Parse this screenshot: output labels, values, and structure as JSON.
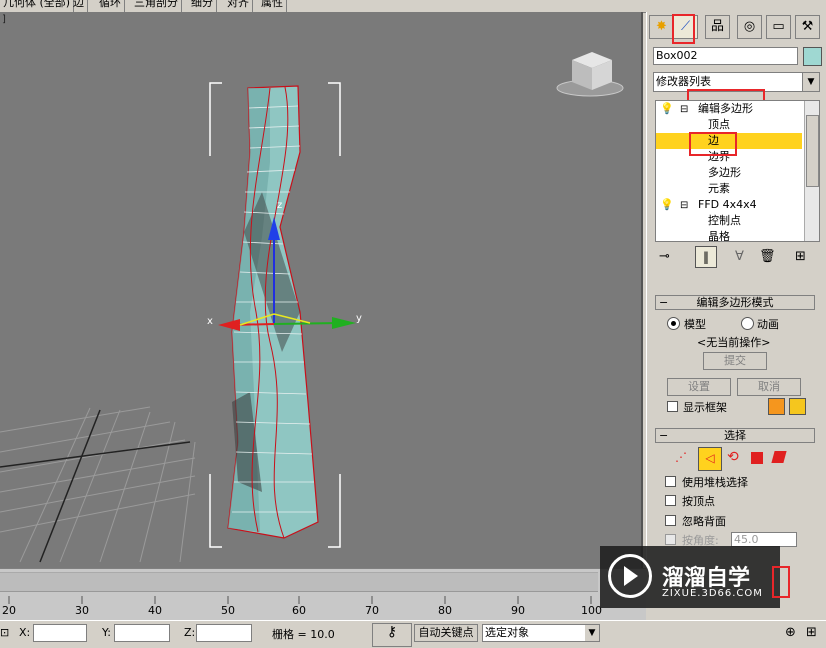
{
  "menubar": {
    "items": [
      "几何体 (全部)",
      "边",
      "循环",
      "三角剖分",
      "细分",
      "对齐",
      "属性"
    ]
  },
  "viewport": {
    "label": "]",
    "gizmo_x": "x",
    "gizmo_y": "y",
    "gizmo_z": "z"
  },
  "panel": {
    "tabs": [
      "create-icon",
      "modify-icon",
      "hierarchy-icon",
      "motion-icon",
      "display-icon",
      "utilities-icon"
    ],
    "object_name": "Box002",
    "object_color": "#9fd8d2",
    "modifier_list_label": "修改器列表",
    "stack": [
      {
        "label": "编辑多边形",
        "level": 0,
        "expand": "−",
        "selected": false
      },
      {
        "label": "顶点",
        "level": 1,
        "selected": false
      },
      {
        "label": "边",
        "level": 1,
        "selected": true
      },
      {
        "label": "边界",
        "level": 1,
        "selected": false
      },
      {
        "label": "多边形",
        "level": 1,
        "selected": false
      },
      {
        "label": "元素",
        "level": 1,
        "selected": false
      },
      {
        "label": "FFD 4x4x4",
        "level": 0,
        "expand": "−",
        "selected": false
      },
      {
        "label": "控制点",
        "level": 1,
        "selected": false
      },
      {
        "label": "晶格",
        "level": 1,
        "selected": false
      }
    ],
    "mode_rollout": {
      "title": "编辑多边形模式",
      "radio_model": "模型",
      "radio_anim": "动画",
      "no_op": "<无当前操作>",
      "commit": "提交",
      "settings": "设置",
      "cancel": "取消",
      "show_cage": "显示框架",
      "cage_color_1": "#f5961e",
      "cage_color_2": "#f5c61e"
    },
    "select_rollout": {
      "title": "选择",
      "use_stack": "使用堆栈选择",
      "by_vertex": "按顶点",
      "ignore_back": "忽略背面",
      "by_angle": "按角度:",
      "angle_value": "45.0"
    }
  },
  "timeline": {
    "ticks": [
      "20",
      "30",
      "40",
      "50",
      "60",
      "70",
      "80",
      "90",
      "100"
    ]
  },
  "status": {
    "x_label": "X:",
    "y_label": "Y:",
    "z_label": "Z:",
    "grid": "栅格 = 10.0",
    "auto_key": "自动关键点",
    "selected_obj": "选定对象"
  },
  "watermark": {
    "brand": "溜溜自学",
    "url": "ZIXUE.3D66.COM"
  }
}
